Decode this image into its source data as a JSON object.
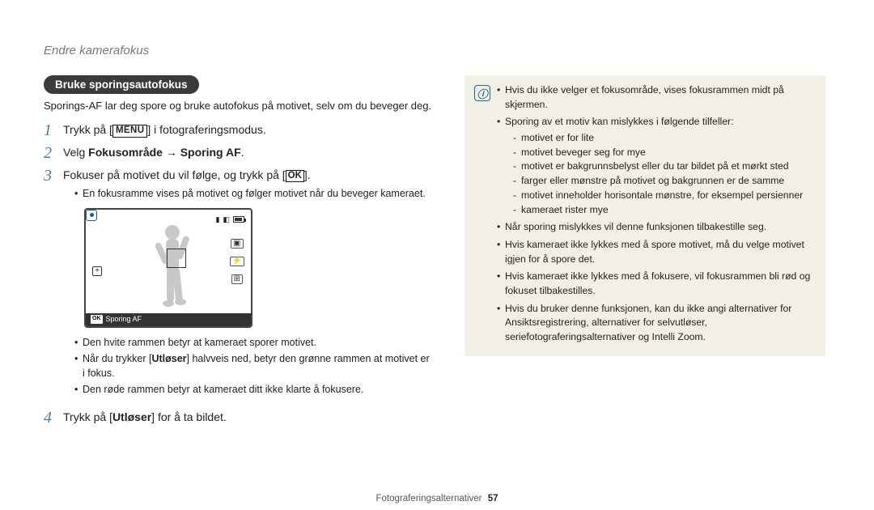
{
  "header_title": "Endre kamerafokus",
  "pill_title": "Bruke sporingsautofokus",
  "intro": "Sporings-AF lar deg spore og bruke autofokus på motivet, selv om du beveger deg.",
  "menu_icon": "MENU",
  "ok_icon": "OK",
  "steps": {
    "s1": {
      "num": "1",
      "pre": "Trykk på [",
      "post": "] i fotograferingsmodus."
    },
    "s2": {
      "num": "2",
      "pre": "Velg ",
      "bold": "Fokusområde → Sporing AF",
      "post": "."
    },
    "s3": {
      "num": "3",
      "pre": "Fokuser på motivet du vil følge, og trykk på [",
      "post": "].",
      "bullets": {
        "b1": "En fokusramme vises på motivet og følger motivet når du beveger kameraet.",
        "b2": "Den hvite rammen betyr at kameraet sporer motivet.",
        "b3_pre": "Når du trykker [",
        "b3_mid": "Utløser",
        "b3_post": "] halvveis ned, betyr den grønne rammen at motivet er i fokus.",
        "b4": "Den røde rammen betyr at kameraet ditt ikke klarte å fokusere."
      }
    },
    "s4": {
      "num": "4",
      "pre": "Trykk på [",
      "mid": "Utløser",
      "post": "] for å ta bildet."
    }
  },
  "screen": {
    "ok": "OK",
    "mode": "Sporing AF"
  },
  "tip": {
    "icon": "!",
    "t1": "Hvis du ikke velger et fokusområde, vises fokusrammen midt på skjermen.",
    "t2": "Sporing av et motiv kan mislykkes i følgende tilfeller:",
    "sub": {
      "a": "motivet er for lite",
      "b": "motivet beveger seg for mye",
      "c": "motivet er bakgrunnsbelyst eller du tar bildet på et mørkt sted",
      "d": "farger eller mønstre på motivet og bakgrunnen er de samme",
      "e": "motivet inneholder horisontale mønstre, for eksempel persienner",
      "f": "kameraet rister mye"
    },
    "t3": "Når sporing mislykkes vil denne funksjonen tilbakestille seg.",
    "t4": "Hvis kameraet ikke lykkes med å spore motivet, må du velge motivet igjen for å spore det.",
    "t5": "Hvis kameraet ikke lykkes med å fokusere, vil fokusrammen bli rød og fokuset tilbakestilles.",
    "t6": "Hvis du bruker denne funksjonen, kan du ikke angi alternativer for Ansiktsregistrering, alternativer for selvutløser, seriefotograferingsalternativer og Intelli Zoom."
  },
  "footer": {
    "section": "Fotograferingsalternativer",
    "page": "57"
  }
}
